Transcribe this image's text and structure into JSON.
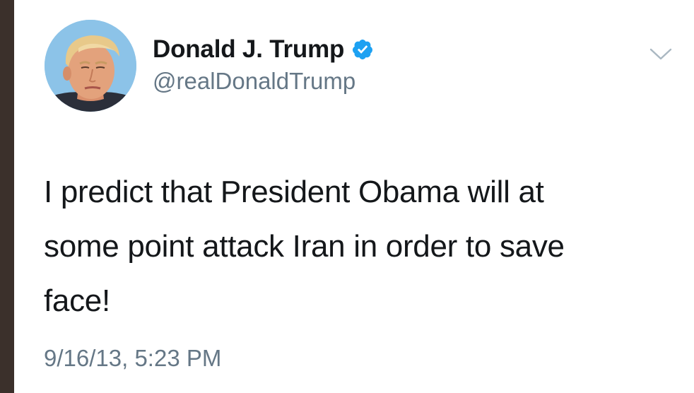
{
  "tweet": {
    "author": {
      "display_name": "Donald J. Trump",
      "handle": "@realDonaldTrump",
      "verified": true,
      "avatar_icon": "profile-photo-avatar"
    },
    "text_lines": [
      "I predict that President Obama will at",
      "some point attack Iran in order to save",
      "face!"
    ],
    "timestamp": "9/16/13, 5:23 PM",
    "menu_icon": "chevron-down-icon"
  },
  "colors": {
    "primary_text": "#14171a",
    "secondary_text": "#657786",
    "verified_blue": "#1da1f2",
    "chevron_gray": "#aab8c2",
    "background": "#ffffff"
  }
}
